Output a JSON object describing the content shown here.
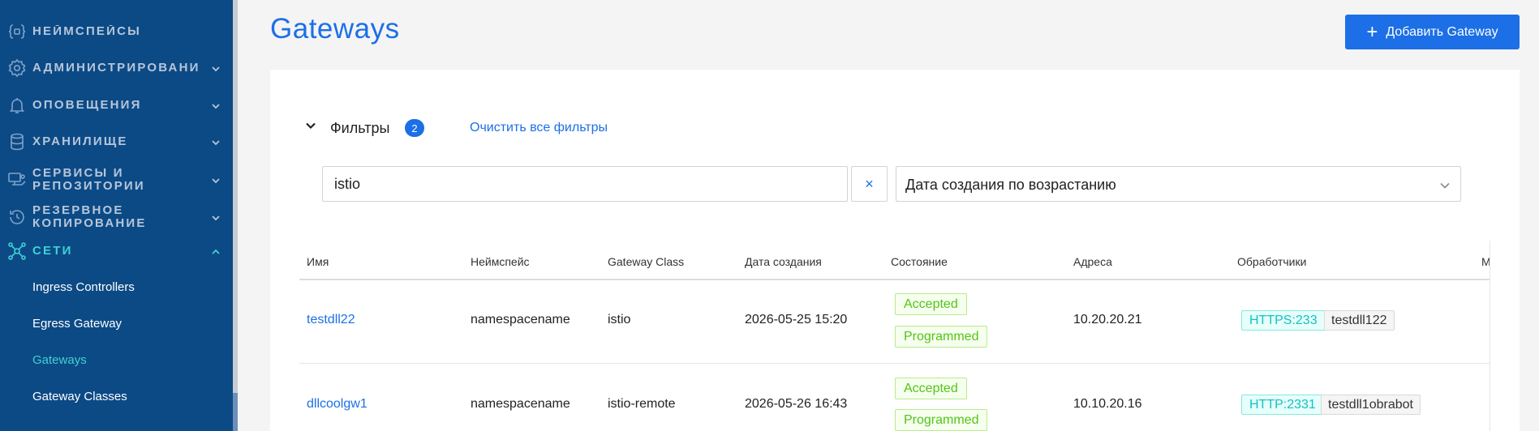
{
  "sidebar": {
    "items": [
      {
        "label": "НЕЙМСПЕЙСЫ",
        "icon": "namespace-icon"
      },
      {
        "label": "АДМИНИСТРИРОВАНИЕ",
        "icon": "gear-icon"
      },
      {
        "label": "ОПОВЕЩЕНИЯ",
        "icon": "bell-icon"
      },
      {
        "label": "ХРАНИЛИЩЕ",
        "icon": "database-icon"
      },
      {
        "label": "СЕРВИСЫ И РЕПОЗИТОРИИ",
        "icon": "services-icon"
      },
      {
        "label": "РЕЗЕРВНОЕ КОПИРОВАНИЕ",
        "icon": "backup-icon"
      },
      {
        "label": "СЕТИ",
        "icon": "network-icon"
      }
    ],
    "network_subitems": [
      {
        "label": "Ingress Controllers"
      },
      {
        "label": "Egress Gateway"
      },
      {
        "label": "Gateways"
      },
      {
        "label": "Gateway Classes"
      }
    ]
  },
  "header": {
    "title": "Gateways",
    "add_button_label": "Добавить Gateway"
  },
  "filters": {
    "label": "Фильтры",
    "count": "2",
    "clear_all_label": "Очистить все фильтры",
    "search_value": "istio",
    "clear_symbol": "×",
    "sort_value": "Дата создания по возрастанию"
  },
  "table": {
    "columns": [
      "Имя",
      "Неймспейс",
      "Gateway Class",
      "Дата создания",
      "Состояние",
      "Адреса",
      "Обработчики",
      "М"
    ],
    "rows": [
      {
        "name": "testdll22",
        "namespace": "namespacename",
        "gateway_class": "istio",
        "created": "2026-05-25 15:20",
        "status": [
          "Accepted",
          "Programmed"
        ],
        "address": "10.20.20.21",
        "listener_proto": "HTTPS:233",
        "listener_name": "testdll122"
      },
      {
        "name": "dllcoolgw1",
        "namespace": "namespacename",
        "gateway_class": "istio-remote",
        "created": "2026-05-26 16:43",
        "status": [
          "Accepted",
          "Programmed"
        ],
        "address": "10.10.20.16",
        "listener_proto": "HTTP:2331",
        "listener_name": "testdll1obrabot"
      }
    ]
  },
  "colors": {
    "sidebar_bg": "#0c4a86",
    "accent": "#1c6fe6",
    "active_nav": "#3fd1d3",
    "status_green": "#52c41a",
    "tag_cyan": "#13c2c2"
  }
}
